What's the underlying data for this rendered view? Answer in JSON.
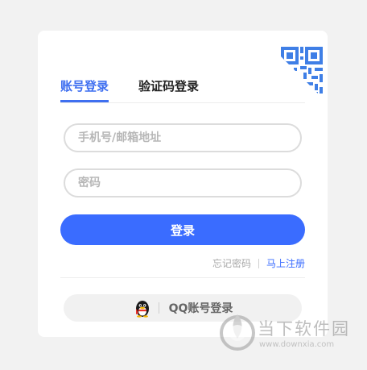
{
  "tabs": {
    "account": "账号登录",
    "sms": "验证码登录"
  },
  "form": {
    "phone_placeholder": "手机号/邮箱地址",
    "password_placeholder": "密码",
    "login_label": "登录"
  },
  "links": {
    "forgot": "忘记密码",
    "register": "马上注册"
  },
  "qq": {
    "label": "QQ账号登录"
  },
  "watermark": {
    "title": "当下软件园",
    "url": "www.downxia.com"
  },
  "colors": {
    "accent": "#3a6cff",
    "qr": "#3f7fe6"
  },
  "icons": {
    "qr_corner": "qr-code-icon",
    "qq": "qq-penguin-icon"
  }
}
